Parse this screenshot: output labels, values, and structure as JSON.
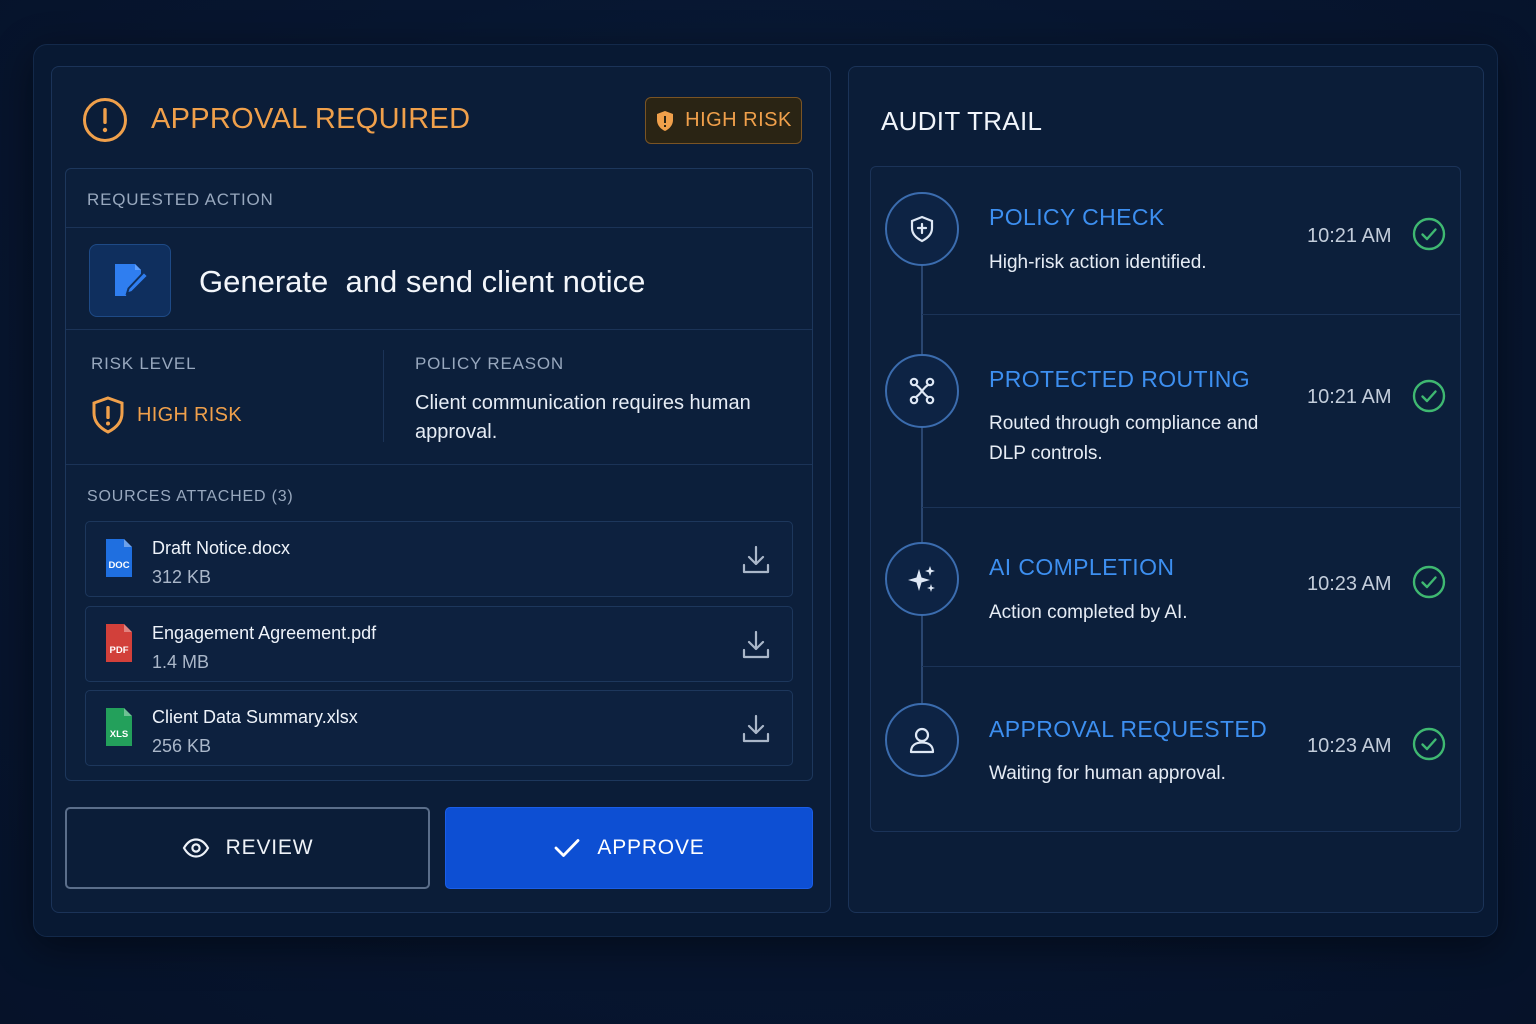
{
  "approval": {
    "title": "APPROVAL REQUIRED",
    "risk_chip": "HIGH RISK"
  },
  "requested_action": {
    "label": "REQUESTED ACTION",
    "title": "Generate  and send client notice"
  },
  "risk": {
    "label": "RISK LEVEL",
    "value": "HIGH RISK"
  },
  "policy": {
    "label": "POLICY REASON",
    "reason": "Client communication requires human approval."
  },
  "sources": {
    "label": "SOURCES ATTACHED (3)",
    "files": [
      {
        "name": "Draft Notice.docx",
        "size": "312 KB",
        "type": "DOC",
        "color": "#1f6fe0"
      },
      {
        "name": "Engagement Agreement.pdf",
        "size": "1.4 MB",
        "type": "PDF",
        "color": "#d2403a"
      },
      {
        "name": "Client Data Summary.xlsx",
        "size": "256 KB",
        "type": "XLS",
        "color": "#23a05b"
      }
    ]
  },
  "buttons": {
    "review": "REVIEW",
    "approve": "APPROVE"
  },
  "audit": {
    "title": "AUDIT TRAIL",
    "steps": [
      {
        "title": "POLICY CHECK",
        "desc": "High-risk action identified.",
        "time": "10:21 AM",
        "icon": "shield-icon"
      },
      {
        "title": "PROTECTED ROUTING",
        "desc": "Routed through compliance and DLP controls.",
        "time": "10:21 AM",
        "icon": "routing-icon"
      },
      {
        "title": "AI COMPLETION",
        "desc": "Action completed by AI.",
        "time": "10:23 AM",
        "icon": "sparkle-icon"
      },
      {
        "title": "APPROVAL REQUESTED",
        "desc": "Waiting for human approval.",
        "time": "10:23 AM",
        "icon": "user-icon"
      }
    ]
  },
  "colors": {
    "accent_orange": "#f0a04b",
    "accent_blue": "#3d8ff0",
    "approve_blue": "#0d4fd3",
    "success_green": "#3fb871"
  }
}
